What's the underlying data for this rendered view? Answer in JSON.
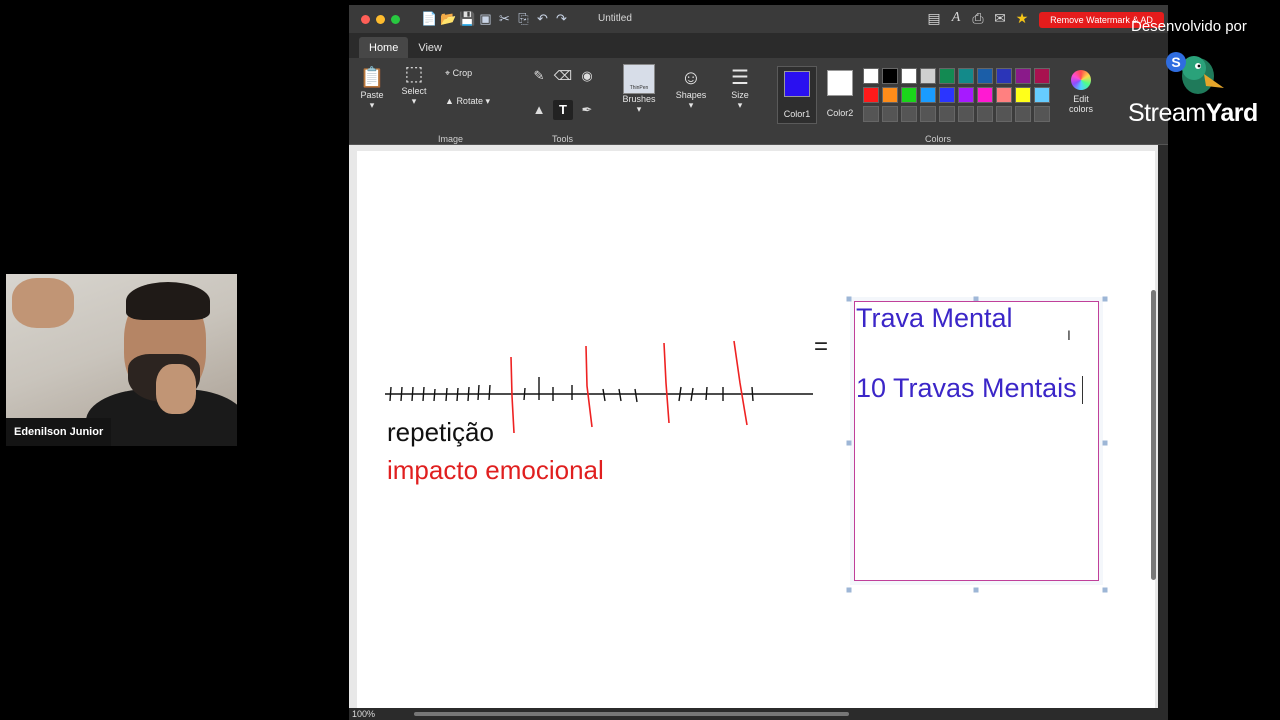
{
  "window": {
    "title": "Untitled",
    "remove_watermark": "Remove Watermark & AD",
    "tabs": [
      "Home",
      "View"
    ]
  },
  "ribbon": {
    "paste": "Paste",
    "select": "Select",
    "crop": "Crop",
    "rotate": "Rotate",
    "group_image": "Image",
    "group_tools": "Tools",
    "brushes": "Brushes",
    "brushes_thumb": "ThinPen",
    "shapes": "Shapes",
    "size": "Size",
    "color1": "Color1",
    "color2": "Color2",
    "group_colors": "Colors",
    "edit_colors": "Edit colors",
    "color1_value": "#2a10f0",
    "color2_value": "#ffffff",
    "palette": [
      "#ffffff",
      "#000000",
      "#ffffff",
      "#cfcfcf",
      "#138a52",
      "#138a8a",
      "#1b5ea8",
      "#2b35b8",
      "#8a1a8a",
      "#a8124f",
      "#ff1a1a",
      "#ff8c1a",
      "#1ad61a",
      "#1a9cff",
      "#2b35ff",
      "#a61aff",
      "#ff1ad2",
      "#ff8080",
      "#ffff1a",
      "#66ccff",
      "#555555",
      "#555555",
      "#555555",
      "#555555",
      "#555555",
      "#555555",
      "#555555",
      "#555555",
      "#555555",
      "#555555"
    ]
  },
  "canvas": {
    "text_repeticao": "repetição",
    "text_impacto": "impacto emocional",
    "text_equals": "=",
    "box_line1": "Trava Mental",
    "box_line2": "10 Travas Mentais"
  },
  "status": {
    "zoom": "100%"
  },
  "webcam": {
    "name": "Edenilson Junior"
  },
  "branding": {
    "developed_by": "Desenvolvido por",
    "name_light": "Stream",
    "name_bold": "Yard"
  }
}
